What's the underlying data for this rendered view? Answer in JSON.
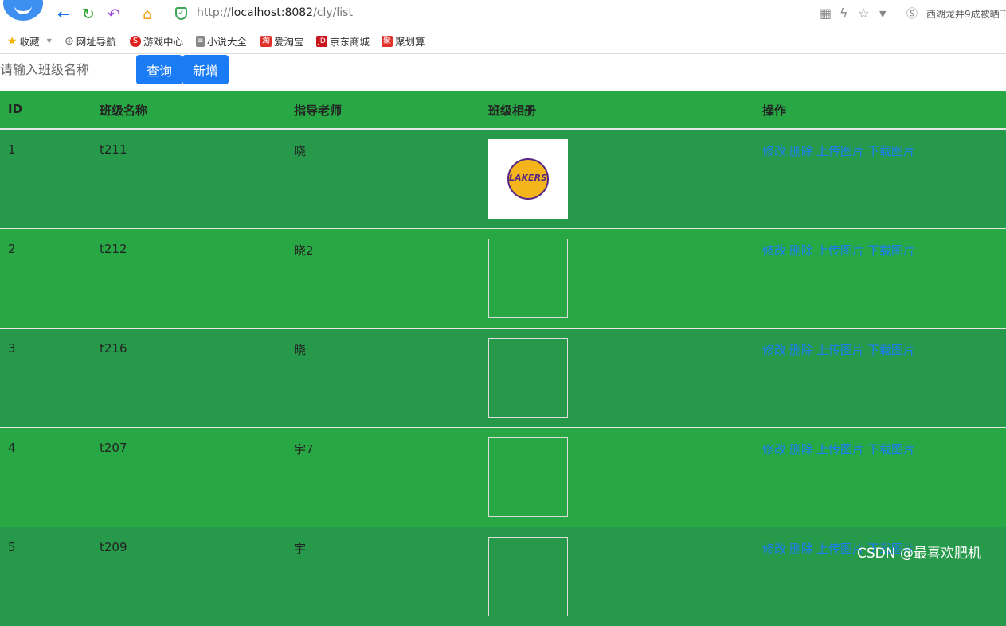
{
  "browser": {
    "url_prefix": "http://",
    "url_host": "localhost:8082",
    "url_path": "/cly/list",
    "news_ticker": "西湖龙井9成被晒干"
  },
  "bookmarks": [
    {
      "label": "收藏",
      "icon": "star-icon",
      "color": "#f5b301"
    },
    {
      "label": "网址导航",
      "icon": "globe-icon",
      "color": "#666666"
    },
    {
      "label": "游戏中心",
      "icon": "game-icon",
      "color": "#e02020"
    },
    {
      "label": "小说大全",
      "icon": "book-icon",
      "color": "#666666"
    },
    {
      "label": "爱淘宝",
      "icon": "taobao-icon",
      "color": "#e0302a"
    },
    {
      "label": "京东商城",
      "icon": "jd-icon",
      "color": "#c9151e"
    },
    {
      "label": "聚划算",
      "icon": "juhuasuan-icon",
      "color": "#e0302a"
    }
  ],
  "toolbar": {
    "search_placeholder": "请输入班级名称",
    "query_label": "查询",
    "add_label": "新增"
  },
  "table": {
    "headers": [
      "ID",
      "班级名称",
      "指导老师",
      "班级相册",
      "操作"
    ],
    "rows": [
      {
        "id": "1",
        "name": "t211",
        "teacher": "晓",
        "photo_loaded": true
      },
      {
        "id": "2",
        "name": "t212",
        "teacher": "晓2",
        "photo_loaded": false
      },
      {
        "id": "3",
        "name": "t216",
        "teacher": "晓",
        "photo_loaded": false
      },
      {
        "id": "4",
        "name": "t207",
        "teacher": "宇7",
        "photo_loaded": false
      },
      {
        "id": "5",
        "name": "t209",
        "teacher": "宇",
        "photo_loaded": false
      }
    ],
    "actions": [
      "修改",
      "删除",
      "上传图片",
      "下载图片"
    ]
  },
  "photo_logo_text": "LAKERS",
  "watermark": "CSDN @最喜欢肥机",
  "colors": {
    "row_green": "#28a745",
    "row_green_alt": "#26994a",
    "link_blue": "#1a7cf5",
    "button_blue": "#1a7cf5"
  }
}
